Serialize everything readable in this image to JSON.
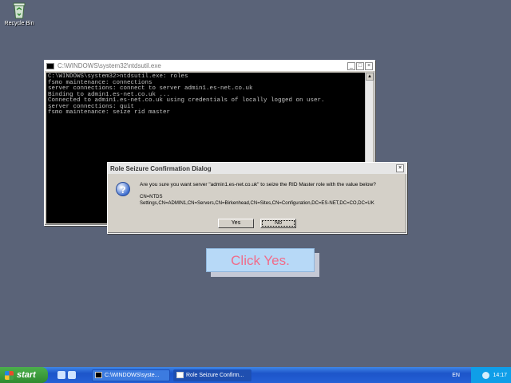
{
  "desktop": {
    "recycle_bin_label": "Recycle Bin"
  },
  "console": {
    "title": "C:\\WINDOWS\\system32\\ntdsutil.exe",
    "lines": "C:\\WINDOWS\\system32>ntdsutil.exe: roles\nfsmo maintenance: connections\nserver connections: connect to server admin1.es-net.co.uk\nBinding to admin1.es-net.co.uk ...\nConnected to admin1.es-net.co.uk using credentials of locally logged on user.\nserver connections: quit\nfsmo maintenance: seize rid master"
  },
  "dialog": {
    "title": "Role Seizure Confirmation Dialog",
    "question": "Are you sure you want server \"admin1.es-net.co.uk\" to seize the RID Master role with the value below?",
    "value_line1": "CN=NTDS",
    "value_line2": "Settings,CN=ADMIN1,CN=Servers,CN=Birkenhead,CN=Sites,CN=Configuration,DC=ES-NET,DC=CO,DC=UK",
    "yes_label": "Yes",
    "no_label": "No"
  },
  "callout": {
    "text": "Click Yes."
  },
  "taskbar": {
    "start_label": "start",
    "tasks": [
      {
        "label": "C:\\WINDOWS\\syste..."
      },
      {
        "label": "Role Seizure Confirm..."
      }
    ],
    "language": "EN",
    "clock": "14:17"
  },
  "colors": {
    "desktop": "#5a6378",
    "callout_bg": "#b7d9f7",
    "callout_text": "#f06c8a",
    "taskbar": "#2460d6"
  },
  "icons": [
    "recycle-bin-icon",
    "console-icon",
    "question-icon",
    "close-icon",
    "minimize-icon",
    "maximize-icon",
    "windows-flag-icon"
  ]
}
